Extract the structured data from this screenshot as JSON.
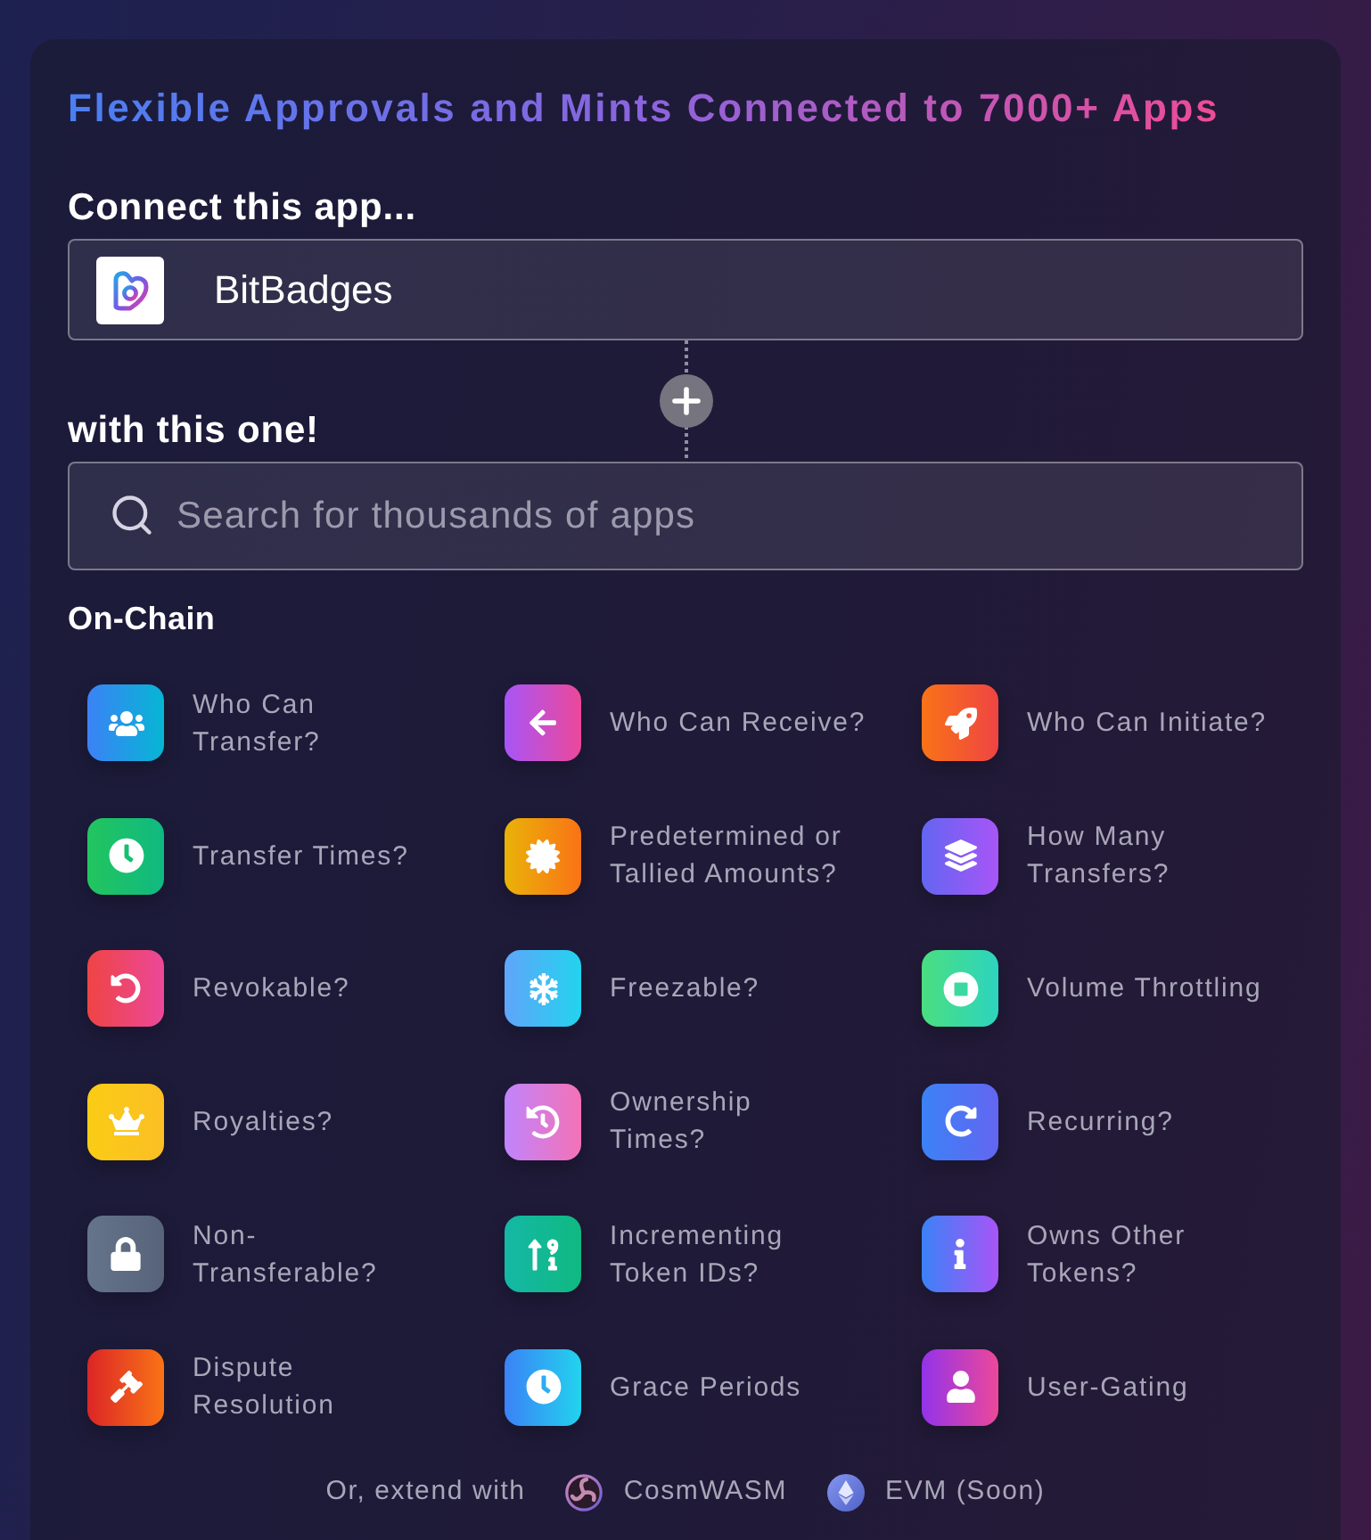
{
  "title": "Flexible Approvals and Mints Connected to 7000+ Apps",
  "source": {
    "label": "Connect this app...",
    "app": {
      "name": "BitBadges"
    }
  },
  "target": {
    "label": "with this one!",
    "search": {
      "placeholder": "Search for thousands of apps"
    }
  },
  "on_chain": {
    "title": "On-Chain",
    "features": [
      {
        "kind": "senders",
        "lines": [
          "Who Can",
          "Transfer?"
        ]
      },
      {
        "kind": "recipients",
        "lines": [
          "Who Can Receive?"
        ]
      },
      {
        "kind": "initiators",
        "lines": [
          "Who Can Initiate?"
        ]
      },
      {
        "kind": "schedule",
        "lines": [
          "Transfer Times?"
        ]
      },
      {
        "kind": "amounts",
        "lines": [
          "Predetermined or",
          "Tallied Amounts?"
        ]
      },
      {
        "kind": "limits",
        "lines": [
          "How Many",
          "Transfers?"
        ]
      },
      {
        "kind": "revocation",
        "lines": [
          "Revokable?"
        ]
      },
      {
        "kind": "freeze",
        "lines": [
          "Freezable?"
        ]
      },
      {
        "kind": "throttle",
        "lines": [
          "Volume Throttling"
        ]
      },
      {
        "kind": "royalties",
        "lines": [
          "Royalties?"
        ]
      },
      {
        "kind": "ownership",
        "lines": [
          "Ownership",
          "Times?"
        ]
      },
      {
        "kind": "recurring",
        "lines": [
          "Recurring?"
        ]
      },
      {
        "kind": "soulbound",
        "lines": [
          "Non-",
          "Transferable?"
        ]
      },
      {
        "kind": "incrementing",
        "lines": [
          "Incrementing",
          "Token IDs?"
        ]
      },
      {
        "kind": "holdings",
        "lines": [
          "Owns Other",
          "Tokens?"
        ]
      },
      {
        "kind": "dispute",
        "lines": [
          "Dispute",
          "Resolution"
        ]
      },
      {
        "kind": "grace",
        "lines": [
          "Grace Periods"
        ]
      },
      {
        "kind": "gating",
        "lines": [
          "User-Gating"
        ]
      }
    ]
  },
  "footer": {
    "text": "Or, extend with",
    "platforms": [
      {
        "kind": "cosmwasm",
        "name": "CosmWASM"
      },
      {
        "kind": "evm",
        "name": "EVM (Soon)"
      }
    ]
  }
}
